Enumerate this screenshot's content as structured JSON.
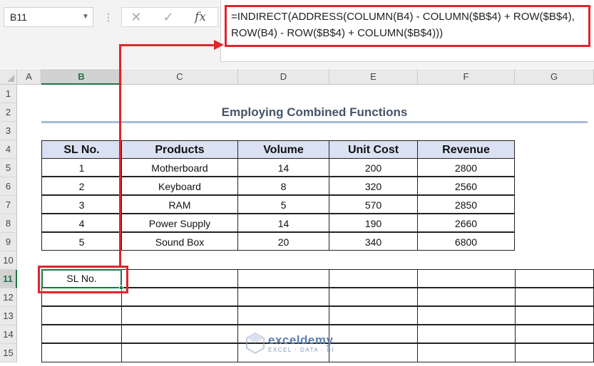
{
  "namebox": {
    "value": "B11"
  },
  "formula_bar": {
    "cancel_glyph": "✕",
    "enter_glyph": "✓",
    "fx_label": "fx",
    "line1": "=INDIRECT(ADDRESS(COLUMN(B4) - COLUMN($B$4) + ROW($B$4),",
    "line2": "ROW(B4) - ROW($B$4) + COLUMN($B$4)))"
  },
  "columns": [
    "A",
    "B",
    "C",
    "D",
    "E",
    "F",
    "G"
  ],
  "selected_column": "B",
  "rows": [
    "1",
    "2",
    "3",
    "4",
    "5",
    "6",
    "7",
    "8",
    "9",
    "10",
    "11",
    "12",
    "13",
    "14",
    "15"
  ],
  "selected_row": "11",
  "sheet": {
    "title": "Employing Combined Functions",
    "table": {
      "headers": [
        "SL No.",
        "Products",
        "Volume",
        "Unit Cost",
        "Revenue"
      ],
      "rows": [
        [
          "1",
          "Motherboard",
          "14",
          "200",
          "2800"
        ],
        [
          "2",
          "Keyboard",
          "8",
          "320",
          "2560"
        ],
        [
          "3",
          "RAM",
          "5",
          "570",
          "2850"
        ],
        [
          "4",
          "Power Supply",
          "14",
          "190",
          "2660"
        ],
        [
          "5",
          "Sound Box",
          "20",
          "340",
          "6800"
        ]
      ]
    },
    "result_cell": {
      "ref": "B11",
      "value": "SL No."
    }
  },
  "watermark": {
    "name": "exceldemy",
    "tagline": "EXCEL · DATA · BI"
  },
  "colors": {
    "accent_red": "#e0242b",
    "excel_green": "#217346",
    "header_fill": "#d9e1f2",
    "title_color": "#44546a"
  }
}
